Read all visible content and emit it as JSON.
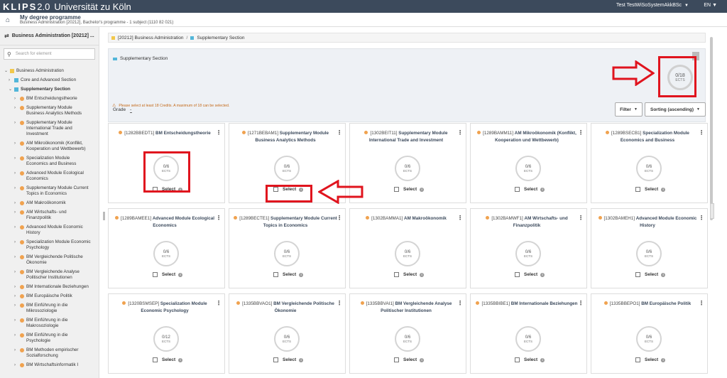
{
  "topbar": {
    "logo": "KLIPS",
    "logo_version": "2.0",
    "university": "Universität zu Köln",
    "user": "Test TestWiSoSystemAkkBSc",
    "language": "EN"
  },
  "subheader": {
    "title": "My degree programme",
    "subtitle": "Business Administration [20212], Bachelor's programme - 1 subject (1110 82 021)"
  },
  "sidebar": {
    "header": "Business Administration [20212] ...",
    "search_placeholder": "Search for element",
    "items": [
      {
        "label": "Business Administration",
        "level": 0,
        "marker": "square-yellow",
        "expanded": true
      },
      {
        "label": "Core and Advanced Section",
        "level": 1,
        "marker": "square-blue",
        "expanded": false
      },
      {
        "label": "Supplementary Section",
        "level": 1,
        "marker": "square-blue",
        "expanded": true
      },
      {
        "label": "BM Entscheidungstheorie",
        "level": 2,
        "marker": "circle-orange"
      },
      {
        "label": "Supplementary Module Business Analytics Methods",
        "level": 2,
        "marker": "circle-orange"
      },
      {
        "label": "Supplementary Module International Trade and Investment",
        "level": 2,
        "marker": "circle-orange"
      },
      {
        "label": "AM Mikroökonomik (Konflikt, Kooperation und Wettbewerb)",
        "level": 2,
        "marker": "circle-orange"
      },
      {
        "label": "Specialization Module Economics and Business",
        "level": 2,
        "marker": "circle-orange"
      },
      {
        "label": "Advanced Module Ecological Economics",
        "level": 2,
        "marker": "circle-orange"
      },
      {
        "label": "Supplementary Module Current Topics in Economics",
        "level": 2,
        "marker": "circle-orange"
      },
      {
        "label": "AM Makroökonomik",
        "level": 2,
        "marker": "circle-orange"
      },
      {
        "label": "AM Wirtschafts- und Finanzpolitik",
        "level": 2,
        "marker": "circle-orange"
      },
      {
        "label": "Advanced Module Economic History",
        "level": 2,
        "marker": "circle-orange"
      },
      {
        "label": "Specialization Module Economic Psychology",
        "level": 2,
        "marker": "circle-orange"
      },
      {
        "label": "BM Vergleichende Politische Ökonomie",
        "level": 2,
        "marker": "circle-orange"
      },
      {
        "label": "BM Vergleichende Analyse Politischer Institutionen",
        "level": 2,
        "marker": "circle-orange"
      },
      {
        "label": "BM Internationale Beziehungen",
        "level": 2,
        "marker": "circle-orange"
      },
      {
        "label": "BM Europäische Politik",
        "level": 2,
        "marker": "circle-orange"
      },
      {
        "label": "BM Einführung in die Mikrosoziologie",
        "level": 2,
        "marker": "circle-orange"
      },
      {
        "label": "BM Einführung in die Makrosoziologie",
        "level": 2,
        "marker": "circle-orange"
      },
      {
        "label": "BM Einführung in die Psychologie",
        "level": 2,
        "marker": "circle-orange"
      },
      {
        "label": "BM Methoden empirischer Sozialforschung",
        "level": 2,
        "marker": "circle-orange"
      },
      {
        "label": "BM Wirtschaftsinformatik I",
        "level": 2,
        "marker": "circle-orange"
      }
    ]
  },
  "breadcrumb": {
    "item1": "[20212] Business Administration",
    "separator": "/",
    "item2": "Supplementary Section"
  },
  "section": {
    "title": "Supplementary Section",
    "grade_label": "Grade",
    "grade_value": "-",
    "ects_value": "0/18",
    "ects_unit": "ECTS",
    "warning": "Please select at least 18 Credits. A maximum of 18 can be selected."
  },
  "controls": {
    "filter_label": "Filter",
    "sort_label": "Sorting (ascending)"
  },
  "cards": [
    {
      "code": "[1282BBEDT1]",
      "name": "BM Entscheidungstheorie",
      "ects": "0/6",
      "unit": "ECTS",
      "select": "Select"
    },
    {
      "code": "[1271BEBAM1]",
      "name": "Supplementary Module Business Analytics Methods",
      "ects": "0/6",
      "unit": "ECTS",
      "select": "Select"
    },
    {
      "code": "[1302BEIT11]",
      "name": "Supplementary Module International Trade and Investment",
      "ects": "0/6",
      "unit": "ECTS",
      "select": "Select"
    },
    {
      "code": "[1289BAMM11]",
      "name": "AM Mikroökonomik (Konflikt, Kooperation und Wettbewerb)",
      "ects": "0/6",
      "unit": "ECTS",
      "select": "Select"
    },
    {
      "code": "[1289BSECB1]",
      "name": "Specialization Module Economics and Business",
      "ects": "0/6",
      "unit": "ECTS",
      "select": "Select"
    },
    {
      "code": "[1289BAMEE1]",
      "name": "Advanced Module Ecological Economics",
      "ects": "0/6",
      "unit": "ECTS",
      "select": "Select"
    },
    {
      "code": "[1289BECTE1]",
      "name": "Supplementary Module Current Topics in Economics",
      "ects": "0/6",
      "unit": "ECTS",
      "select": "Select"
    },
    {
      "code": "[1302BAMMA1]",
      "name": "AM Makroökonomik",
      "ects": "0/6",
      "unit": "ECTS",
      "select": "Select"
    },
    {
      "code": "[1302BAMWF1]",
      "name": "AM Wirtschafts- und Finanzpolitik",
      "ects": "0/6",
      "unit": "ECTS",
      "select": "Select"
    },
    {
      "code": "[1302BAMEH1]",
      "name": "Advanced Module Economic History",
      "ects": "0/6",
      "unit": "ECTS",
      "select": "Select"
    },
    {
      "code": "[1320BSMSEP]",
      "name": "Specialization Module Economic Psychology",
      "ects": "0/12",
      "unit": "ECTS",
      "select": "Select"
    },
    {
      "code": "[1335BBVAO1]",
      "name": "BM Vergleichende Politische Ökonomie",
      "ects": "0/6",
      "unit": "ECTS",
      "select": "Select"
    },
    {
      "code": "[1335BBVAI1]",
      "name": "BM Vergleichende Analyse Politischer Institutionen",
      "ects": "0/6",
      "unit": "ECTS",
      "select": "Select"
    },
    {
      "code": "[1335BBIBE1]",
      "name": "BM Internationale Beziehungen",
      "ects": "0/6",
      "unit": "ECTS",
      "select": "Select"
    },
    {
      "code": "[1335BBEPO1]",
      "name": "BM Europäische Politik",
      "ects": "0/6",
      "unit": "ECTS",
      "select": "Select"
    }
  ],
  "colors": {
    "topbar": "#3c4a5c",
    "annotation_red": "#e0141e",
    "marker_orange": "#f0a24f",
    "marker_blue": "#52b6d9",
    "marker_yellow": "#f2c84b"
  },
  "icons": {
    "home": "home-icon",
    "tree": "tree-icon",
    "search": "search-icon",
    "menu": "kebab-menu-icon",
    "info": "info-icon"
  }
}
